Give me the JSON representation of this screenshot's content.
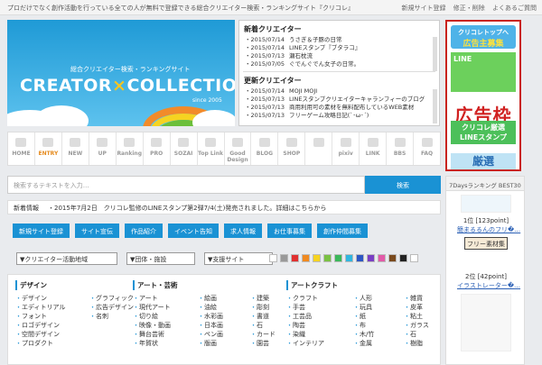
{
  "topbar": {
    "tagline": "プロだけでなく創作活動を行っている全ての人が無料で登録できる総合クリエイター検索・ランキングサイト『クリコレ』",
    "links": [
      "新規サイト登録",
      "修正・削除",
      "よくあるご質問"
    ]
  },
  "banner": {
    "subtitle": "総合クリエイター検索・ランキングサイト",
    "logo_left": "CREATOR",
    "logo_x": "×",
    "logo_right": "COLLECTION",
    "since": "since 2005"
  },
  "new_creators": {
    "title": "新着クリエイター",
    "items": [
      {
        "date": "・2015/07/14",
        "text": "うさぎ＆子豚の日常"
      },
      {
        "date": "・2015/07/14",
        "text": "LINEスタンプ『ブタラコ』"
      },
      {
        "date": "・2015/07/13",
        "text": "瀬石枕流"
      },
      {
        "date": "・2015/07/05",
        "text": "ぐでんぐでん女子の日常。"
      }
    ]
  },
  "updated_creators": {
    "title": "更新クリエイター",
    "items": [
      {
        "date": "・2015/07/14",
        "text": "MOJI MOJI"
      },
      {
        "date": "・2015/07/13",
        "text": "LINEスタンプクリエイターキャランフィーのブログ"
      },
      {
        "date": "・2015/07/13",
        "text": "商用利用可の素材を無料配布しているWEB素材"
      },
      {
        "date": "・2015/07/13",
        "text": "フリーゲーム攻略日記(`･ω･´)"
      }
    ]
  },
  "ad": {
    "b1_top": "クリコレトップへ",
    "b1_main": "広告主募集",
    "b2": "LINE",
    "big": "広告枠",
    "b3_top": "クリコレ厳選",
    "b3_main": "LINEスタンプ",
    "b4": "厳選"
  },
  "nav": [
    {
      "label": "HOME"
    },
    {
      "label": "ENTRY"
    },
    {
      "label": "NEW"
    },
    {
      "label": "UP"
    },
    {
      "label": "Ranking"
    },
    {
      "label": "PRO"
    },
    {
      "label": "SOZAI"
    },
    {
      "label": "Top Link"
    },
    {
      "label": "Good Design"
    },
    {
      "label": "BLOG"
    },
    {
      "label": "SHOP"
    },
    {
      "label": ""
    },
    {
      "label": "pixiv"
    },
    {
      "label": "LINK"
    },
    {
      "label": "BBS"
    },
    {
      "label": "FAQ"
    }
  ],
  "search": {
    "placeholder": "検索するテキストを入力…",
    "button": "検索"
  },
  "news": {
    "label": "新着情報",
    "text": "・2015年7月2日　クリコレ監修のLINEスタンプ第2弾7/4(土)発売されました。詳細はこちらから"
  },
  "buttons": [
    "新規サイト登録",
    "サイト宣伝",
    "作品紹介",
    "イベント告知",
    "求人情報",
    "お仕事募集",
    "創作仲間募集"
  ],
  "filters": [
    {
      "label": "▼クリエイター活動地域"
    },
    {
      "label": "▼団体・施設"
    },
    {
      "label": "▼支援サイト"
    }
  ],
  "swatches": [
    "#ffffff",
    "#999999",
    "#e03030",
    "#f08a20",
    "#f6d321",
    "#7ac143",
    "#3bb85a",
    "#30b6e0",
    "#2c56c4",
    "#7a3fc4",
    "#e25aa8",
    "#7a4a1e",
    "#222222",
    "#ffffff"
  ],
  "categories": {
    "design": {
      "title": "デザイン",
      "items": [
        "デザイン",
        "グラフィック",
        "エディトリアル",
        "広告デザイン",
        "フォント",
        "名刺",
        "ロゴデザイン",
        "",
        "空間デザイン",
        "",
        "プロダクト",
        ""
      ]
    },
    "art": {
      "title": "アート・芸術",
      "items": [
        "アート",
        "絵画",
        "建築",
        "現代アート",
        "油絵",
        "彫刻",
        "切り絵",
        "水彩画",
        "書道",
        "映像・動画",
        "日本画",
        "石",
        "舞台芸術",
        "ペン画",
        "カード",
        "年賀状",
        "版画",
        "園芸"
      ]
    },
    "craft": {
      "title": "アートクラフト",
      "items": [
        "クラフト",
        "人形",
        "雑貨",
        "手芸",
        "玩具",
        "皮革",
        "工芸品",
        "紙",
        "粘土",
        "陶芸",
        "布",
        "ガラス",
        "染織",
        "木/竹",
        "石",
        "インテリア",
        "金属",
        "樹脂"
      ]
    }
  },
  "ranking": {
    "header": "7Daysランキング BEST30",
    "entries": [
      {
        "rank": "1位 [123point]",
        "title": "簡まるるんのフリ�…",
        "tag": "フリー素材集"
      },
      {
        "rank": "2位 [42point]",
        "title": "イラストレーター�…",
        "tag": ""
      }
    ]
  }
}
